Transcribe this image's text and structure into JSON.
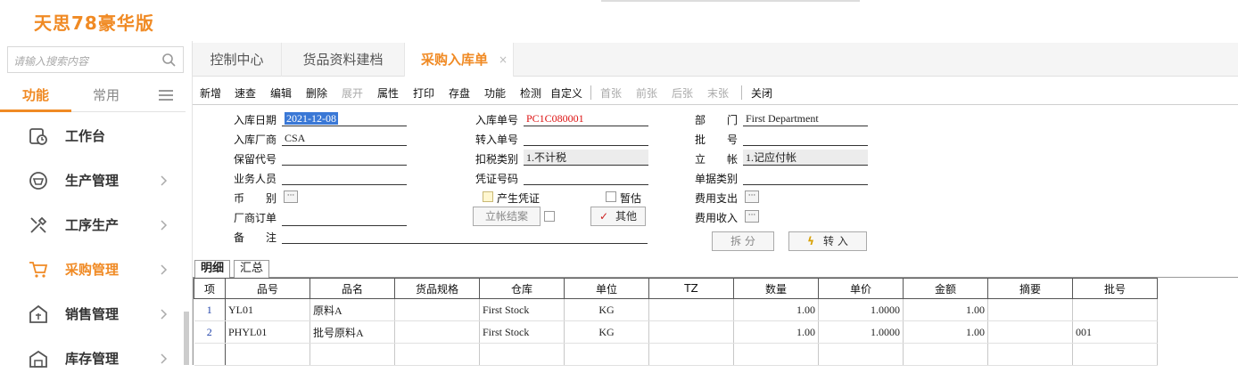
{
  "app": {
    "logo_text": "天思78豪华版",
    "brand_color": "#f08a24"
  },
  "sidebar": {
    "search_placeholder": "请输入搜索内容",
    "tabs": [
      {
        "label": "功能"
      },
      {
        "label": "常用"
      }
    ],
    "items": [
      {
        "label": "工作台",
        "icon": "clock-icon"
      },
      {
        "label": "生产管理",
        "icon": "factory-icon"
      },
      {
        "label": "工序生产",
        "icon": "tools-icon"
      },
      {
        "label": "采购管理",
        "icon": "cart-icon"
      },
      {
        "label": "销售管理",
        "icon": "sales-icon"
      },
      {
        "label": "库存管理",
        "icon": "warehouse-icon"
      }
    ]
  },
  "page_tabs": [
    {
      "label": "控制中心"
    },
    {
      "label": "货品资料建档"
    },
    {
      "label": "采购入库单",
      "close": "×"
    }
  ],
  "toolbar": {
    "items": [
      "新增",
      "速查",
      "编辑",
      "删除",
      "展开",
      "属性",
      "打印",
      "存盘",
      "功能",
      "检测",
      "自定义",
      "首张",
      "前张",
      "后张",
      "末张",
      "关闭"
    ]
  },
  "form": {
    "in_date_label": "入库日期",
    "in_date": "2021-12-08",
    "vendor_label": "入库厂商",
    "vendor": "CSA",
    "reserve_label": "保留代号",
    "reserve": "",
    "staff_label": "业务人员",
    "staff": "",
    "currency_label": "币　　别",
    "currency": "",
    "vendor_order_label": "厂商订单",
    "vendor_order": "",
    "note_label": "备　　注",
    "note": "",
    "doc_no_label": "入库单号",
    "doc_no": "PC1C080001",
    "transfer_no_label": "转入单号",
    "transfer_no": "",
    "tax_type_label": "扣税类别",
    "tax_type": "1.不计税",
    "voucher_label": "凭证号码",
    "voucher": "",
    "gen_voucher_label": "产生凭证",
    "provisional_label": "暂估",
    "settle_btn": "立帐结案",
    "other_btn": "其他",
    "dept_label": "部　　门",
    "dept": "First Department",
    "batch_label": "批　　号",
    "batch": "",
    "account_label": "立　　帐",
    "account": "1.记应付帐",
    "doc_type_label": "单据类别",
    "doc_type": "",
    "expense_label": "费用支出",
    "income_label": "费用收入",
    "split_btn": "拆 分",
    "transfer_btn": "转 入"
  },
  "detail_tabs": [
    {
      "label": "明细"
    },
    {
      "label": "汇总"
    }
  ],
  "grid": {
    "columns": [
      "项",
      "品号",
      "品名",
      "货品规格",
      "仓库",
      "单位",
      "TZ",
      "数量",
      "单价",
      "金额",
      "摘要",
      "批号"
    ],
    "rows": [
      {
        "idx": "1",
        "code": "YL01",
        "name": "原料A",
        "spec": "",
        "wh": "First Stock",
        "unit": "KG",
        "tz": "",
        "qty": "1.00",
        "price": "1.0000",
        "amount": "1.00",
        "memo": "",
        "batch": ""
      },
      {
        "idx": "2",
        "code": "PHYL01",
        "name": "批号原料A",
        "spec": "",
        "wh": "First Stock",
        "unit": "KG",
        "tz": "",
        "qty": "1.00",
        "price": "1.0000",
        "amount": "1.00",
        "memo": "",
        "batch": "001"
      }
    ]
  }
}
